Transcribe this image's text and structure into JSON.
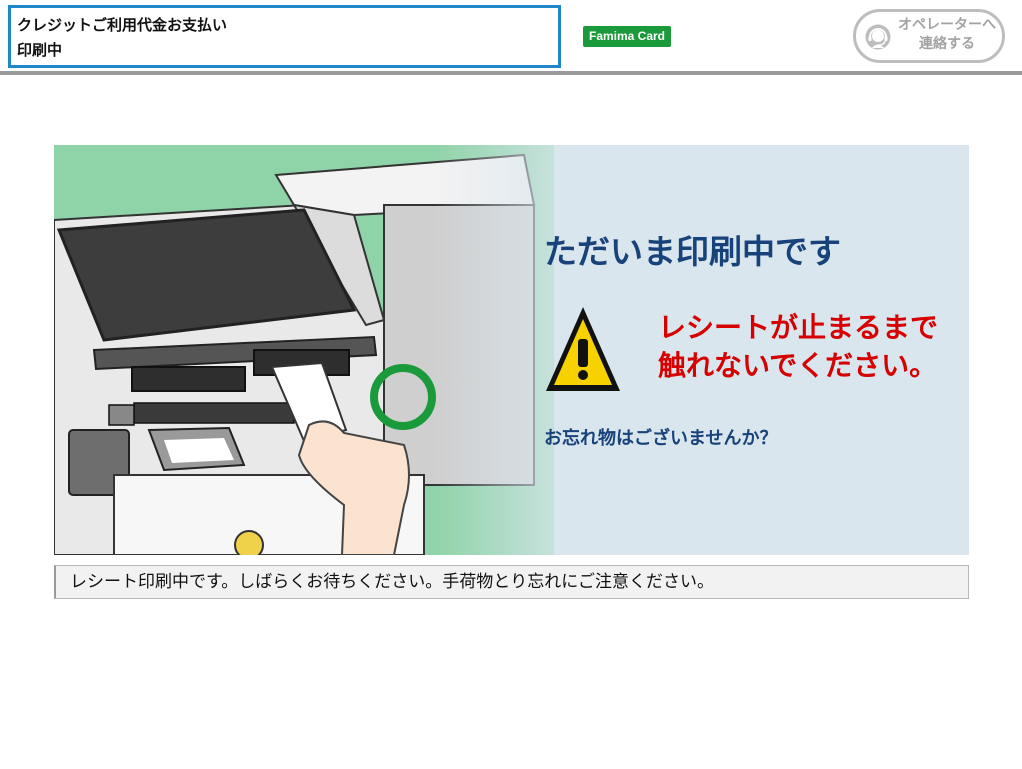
{
  "header": {
    "title_line1": "クレジットご利用代金お支払い",
    "title_line2": "印刷中",
    "brand": "Famima Card",
    "operator_button": "オペレーターへ\n連絡する",
    "operator_icon": "headset-operator-icon"
  },
  "panel": {
    "heading": "ただいま印刷中です",
    "warning_line1": "レシートが止まるまで",
    "warning_line2": "触れないでください。",
    "forgot_message": "お忘れ物はございませんか？",
    "warning_icon": "warning-triangle-icon"
  },
  "status": {
    "message": "レシート印刷中です。しばらくお待ちください。手荷物とり忘れにご注意ください。"
  },
  "colors": {
    "title_border": "#1f87c9",
    "brand_green": "#1a9a3b",
    "heading_navy": "#17427a",
    "warning_red": "#d60000",
    "highlight_ring": "#1a9a3b",
    "panel_bg": "#d9e6ee"
  }
}
